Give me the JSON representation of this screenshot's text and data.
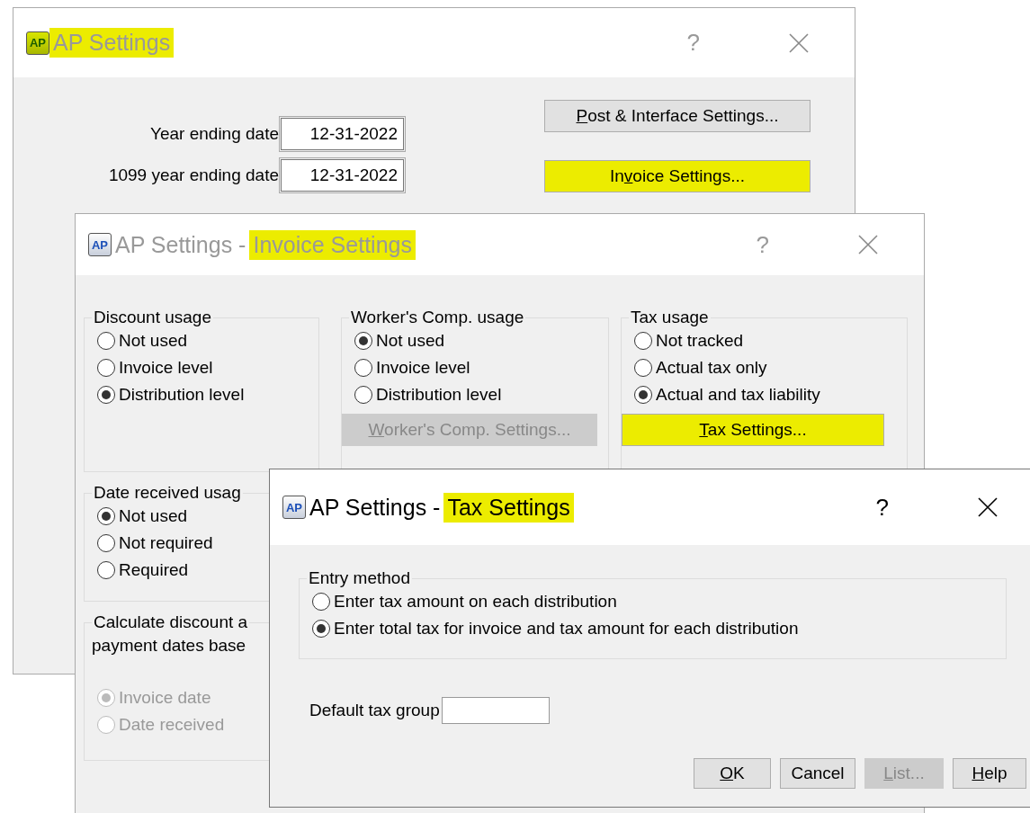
{
  "main_window": {
    "app_icon": "AP",
    "active": false,
    "title": [
      {
        "text": "AP Settings",
        "highlighted": true
      }
    ],
    "help": "?",
    "fields": [
      {
        "label": "Year ending date",
        "value": "12-31-2022"
      },
      {
        "label": "1099 year ending date",
        "value": "12-31-2022"
      }
    ],
    "buttons": [
      {
        "label_parts": [
          {
            "text": "P",
            "underlined": true
          },
          {
            "text": "ost & Interface Settings...",
            "underlined": false
          }
        ],
        "highlighted": false,
        "disabled": false
      },
      {
        "label_parts": [
          {
            "text": "In",
            "underlined": false
          },
          {
            "text": "v",
            "underlined": true
          },
          {
            "text": "oice Settings...",
            "underlined": false
          }
        ],
        "highlighted": true,
        "disabled": false
      }
    ]
  },
  "invoice_window": {
    "app_icon": "AP",
    "active": false,
    "title": [
      {
        "text": "AP Settings -",
        "highlighted": false
      },
      {
        "text": "Invoice Settings",
        "highlighted": true
      }
    ],
    "help": "?",
    "groups": [
      {
        "title_lines": [
          "Discount usage"
        ],
        "options": [
          {
            "label": "Not used",
            "selected": false,
            "disabled": false
          },
          {
            "label": "Invoice level",
            "selected": false,
            "disabled": false
          },
          {
            "label": "Distribution level",
            "selected": true,
            "disabled": false
          }
        ]
      },
      {
        "title_lines": [
          "Worker's Comp. usage"
        ],
        "options": [
          {
            "label": "Not used",
            "selected": true,
            "disabled": false
          },
          {
            "label": "Invoice level",
            "selected": false,
            "disabled": false
          },
          {
            "label": "Distribution level",
            "selected": false,
            "disabled": false
          }
        ],
        "button": {
          "label_parts": [
            {
              "text": "W",
              "underlined": true
            },
            {
              "text": "orker's Comp. Settings...",
              "underlined": false
            }
          ],
          "highlighted": false,
          "disabled": true
        }
      },
      {
        "title_lines": [
          "Tax usage"
        ],
        "options": [
          {
            "label": "Not tracked",
            "selected": false,
            "disabled": false
          },
          {
            "label": "Actual tax only",
            "selected": false,
            "disabled": false
          },
          {
            "label": "Actual and tax liability",
            "selected": true,
            "disabled": false
          }
        ],
        "button": {
          "label_parts": [
            {
              "text": "T",
              "underlined": true
            },
            {
              "text": "ax Settings...",
              "underlined": false
            }
          ],
          "highlighted": true,
          "disabled": false
        }
      },
      {
        "title_lines": [
          "Date received usag"
        ],
        "options": [
          {
            "label": "Not used",
            "selected": true,
            "disabled": false
          },
          {
            "label": "Not required",
            "selected": false,
            "disabled": false
          },
          {
            "label": "Required",
            "selected": false,
            "disabled": false
          }
        ]
      },
      {
        "title_lines": [
          "Calculate discount a",
          "payment dates base"
        ],
        "options": [
          {
            "label": "Invoice date",
            "selected": true,
            "disabled": true
          },
          {
            "label": "Date received",
            "selected": false,
            "disabled": true
          }
        ]
      }
    ]
  },
  "tax_window": {
    "app_icon": "AP",
    "active": true,
    "title": [
      {
        "text": "AP Settings -",
        "highlighted": false
      },
      {
        "text": "Tax Settings",
        "highlighted": true
      }
    ],
    "help": "?",
    "groups": [
      {
        "title_lines": [
          "Entry method"
        ],
        "options": [
          {
            "label": "Enter tax amount on each distribution",
            "selected": false,
            "disabled": false
          },
          {
            "label": "Enter total tax for invoice and tax amount for each distribution",
            "selected": true,
            "disabled": false
          }
        ]
      }
    ],
    "fields": [
      {
        "label": "Default tax group"
      }
    ],
    "buttons": [
      {
        "label_parts": [
          {
            "text": "O",
            "underlined": true
          },
          {
            "text": "K",
            "underlined": false
          }
        ],
        "highlighted": false,
        "disabled": false
      },
      {
        "label_parts": [
          {
            "text": "Cancel",
            "underlined": false
          }
        ],
        "highlighted": false,
        "disabled": false
      },
      {
        "label_parts": [
          {
            "text": "L",
            "underlined": true
          },
          {
            "text": "ist...",
            "underlined": false
          }
        ],
        "highlighted": false,
        "disabled": true
      },
      {
        "label_parts": [
          {
            "text": "H",
            "underlined": true
          },
          {
            "text": "elp",
            "underlined": false
          }
        ],
        "highlighted": false,
        "disabled": false
      }
    ]
  }
}
